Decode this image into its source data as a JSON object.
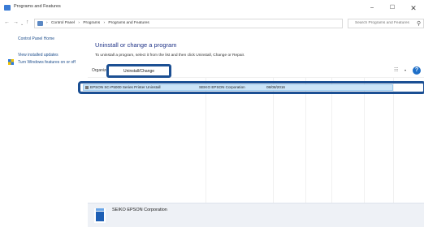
{
  "window": {
    "title": "Programs and Features",
    "controls": {
      "minimize": "−",
      "maximize": "☐",
      "close": "✕"
    }
  },
  "address": {
    "breadcrumb": [
      "Control Panel",
      "Programs",
      "Programs and Features"
    ],
    "separator": "›",
    "search_placeholder": "Search Programs and Features"
  },
  "sidebar": {
    "home": "Control Panel Home",
    "updates": "View installed updates",
    "features": "Turn Windows features on or off"
  },
  "main": {
    "title": "Uninstall or change a program",
    "description": "To uninstall a program, select it from the list and then click Uninstall, Change or Repair."
  },
  "toolbar": {
    "organize": "Organize",
    "uninstall_change": "Uninstall/Change"
  },
  "programs": [
    {
      "name": "EPSON SC-P5000 Series Printer Uninstall",
      "publisher": "SEIKO EPSON Corporation",
      "installed_on": "08/08/2016",
      "selected": true
    }
  ],
  "details": {
    "publisher": "SEIKO EPSON Corporation"
  },
  "colors": {
    "highlight_border": "#1b4f93",
    "selection_bg": "#cce4f7",
    "title_blue": "#1e3287",
    "link_blue": "#1e4e8c"
  }
}
